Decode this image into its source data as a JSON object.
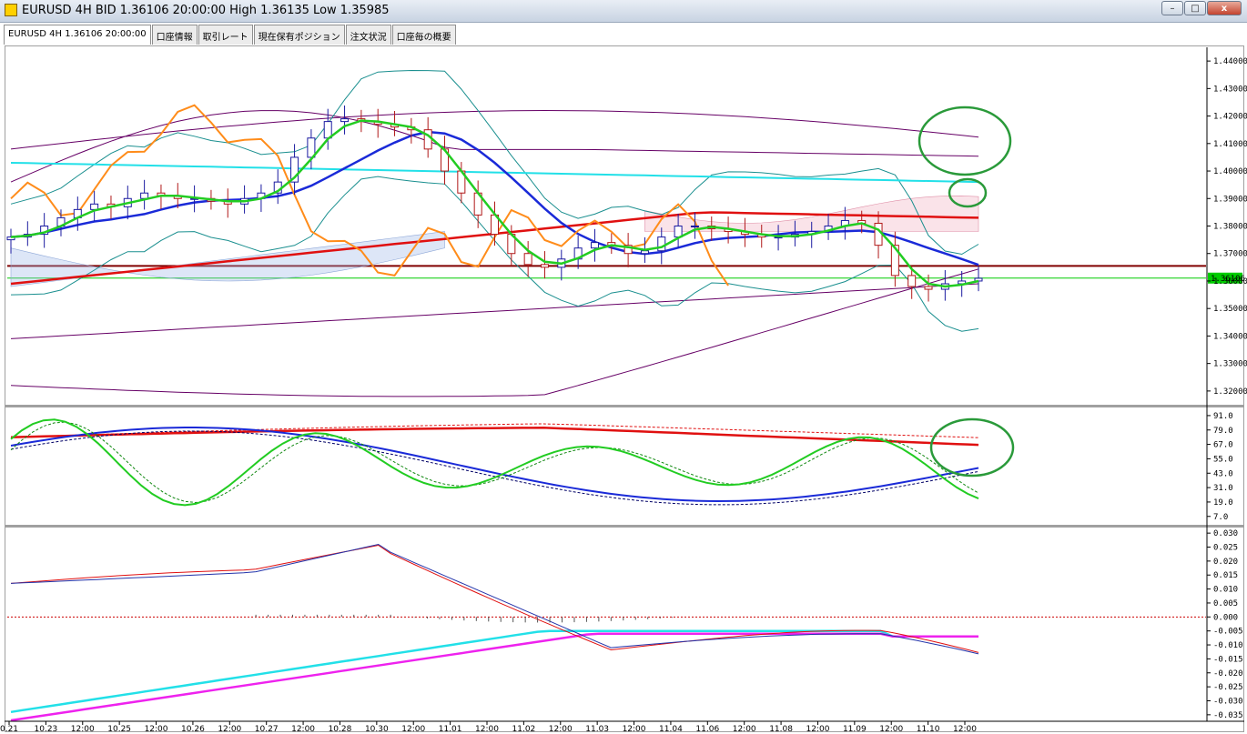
{
  "window": {
    "title": "EURUSD 4H BID 1.36106 20:00:00 High 1.36135 Low 1.35985",
    "minimize": "–",
    "maximize": "□",
    "close": "x"
  },
  "tabs": [
    {
      "label": "EURUSD 4H 1.36106 20:00:00",
      "active": true
    },
    {
      "label": "口座情報",
      "active": false
    },
    {
      "label": "取引レート",
      "active": false
    },
    {
      "label": "現在保有ポジション",
      "active": false
    },
    {
      "label": "注文状況",
      "active": false
    },
    {
      "label": "口座毎の概要",
      "active": false
    }
  ],
  "chart_data": [
    {
      "type": "candlestick",
      "title": "EURUSD 4H",
      "ylim": [
        1.315,
        1.445
      ],
      "y_ticks": [
        "1.44000",
        "1.43000",
        "1.42000",
        "1.41000",
        "1.40000",
        "1.39000",
        "1.38000",
        "1.37000",
        "1.36000",
        "1.35000",
        "1.34000",
        "1.33000",
        "1.32000"
      ],
      "price_label": "1.36106",
      "current_price": 1.36106,
      "horizontal_line": 1.3655,
      "x_dates": [
        "0.21",
        "10.23",
        "12:00",
        "10.25",
        "12:00",
        "10.26",
        "12:00",
        "10.27",
        "12:00",
        "10.28",
        "10.30",
        "12:00",
        "11.01",
        "12:00",
        "11.02",
        "12:00",
        "11.03",
        "12:00",
        "11.04",
        "11.06",
        "12:00",
        "11.08",
        "12:00",
        "11.09",
        "12:00",
        "11.10",
        "12:00"
      ],
      "close_series": [
        1.376,
        1.377,
        1.38,
        1.383,
        1.386,
        1.388,
        1.387,
        1.39,
        1.392,
        1.391,
        1.39,
        1.39,
        1.389,
        1.388,
        1.39,
        1.392,
        1.396,
        1.405,
        1.412,
        1.418,
        1.419,
        1.418,
        1.417,
        1.416,
        1.415,
        1.408,
        1.4,
        1.392,
        1.384,
        1.377,
        1.37,
        1.366,
        1.365,
        1.368,
        1.372,
        1.374,
        1.373,
        1.37,
        1.371,
        1.376,
        1.38,
        1.38,
        1.379,
        1.378,
        1.377,
        1.376,
        1.376,
        1.377,
        1.378,
        1.38,
        1.382,
        1.381,
        1.373,
        1.362,
        1.358,
        1.357,
        1.359,
        1.36,
        1.361
      ],
      "grid": false,
      "legend": "none"
    },
    {
      "type": "line",
      "title": "",
      "ylim": [
        0,
        97
      ],
      "y_ticks": [
        "91.0",
        "79.0",
        "67.0",
        "55.0",
        "43.0",
        "31.0",
        "19.0",
        "7.0"
      ]
    },
    {
      "type": "line",
      "title": "",
      "ylim": [
        -0.037,
        0.032
      ],
      "y_ticks": [
        "0.030",
        "0.025",
        "0.020",
        "0.015",
        "0.010",
        "0.005",
        "0.000",
        "-0.005",
        "-0.010",
        "-0.015",
        "-0.020",
        "-0.025",
        "-0.030",
        "-0.035"
      ]
    }
  ],
  "colors": {
    "up_candle": "#1a1aa0",
    "down_candle": "#b01818",
    "ma_green": "#22cc22",
    "ma_blue": "#1a2ad8",
    "ma_red": "#e01010",
    "orange": "#ff8c1a",
    "cyan": "#22e0e8",
    "magenta": "#ee22ee",
    "teal": "#1a8f8f",
    "purple": "#660066",
    "dark_red": "#800000",
    "circle": "#2a9a3a"
  }
}
